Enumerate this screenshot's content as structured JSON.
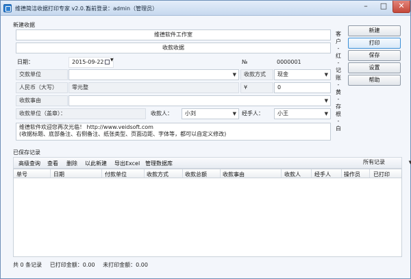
{
  "window": {
    "title": "维德简洁收据打印专家 v2.0.7",
    "current_user": "当前登录：admin（管理员）",
    "controls": {
      "minimize": "–",
      "maximize": "□",
      "close": "✕"
    }
  },
  "receipt_section": {
    "group_label": "新建收据",
    "company_name": "维德软件工作室",
    "receipt_title": "收款收据",
    "date_label": "日期：",
    "date_value": "2015-09-22",
    "number_label": "№",
    "number_value": "0000001",
    "payer_label": "交款单位",
    "payer_value": "",
    "method_label": "收款方式",
    "method_value": "现金",
    "rmb_label": "人民币（大写）",
    "rmb_value": "零元整",
    "yen_label": "¥",
    "amount_value": "0",
    "reason_label": "收款事由",
    "reason_value": "",
    "seal_label": "收款单位（盖章）：",
    "receiver_label": "收款人：",
    "receiver_value": "小刘",
    "handler_label": "经手人：",
    "handler_value": "小王",
    "notes_line1": "维德软件欢迎您再次光临！ http://www.veidsoft.com",
    "notes_line2": "(收据标题、底部备注、右侧备注、纸张类型、页面边距、字体等，都可以自定义修改)",
    "side_note": [
      "客",
      "户",
      "-",
      "红",
      "-",
      "记",
      "账",
      "-",
      "黄",
      "-",
      "存",
      "根",
      "-",
      "白"
    ]
  },
  "buttons": {
    "new": "新建",
    "print": "打印",
    "save": "保存",
    "settings": "设置",
    "help": "帮助"
  },
  "saved_section": {
    "group_label": "已保存记录",
    "toolbar": [
      "高级查询",
      "查看",
      "删除",
      "以此新建",
      "导出Excel",
      "管理数据库"
    ],
    "filter_value": "所有记录",
    "columns": [
      "单号",
      "日期",
      "付款单位",
      "收款方式",
      "收款总额",
      "收款事由",
      "收款人",
      "经手人",
      "操作员",
      "已打印"
    ]
  },
  "status": {
    "records": "共 0 条记录",
    "printed": "已打印金额：0.00",
    "unprinted": "未打印金额：0.00"
  },
  "icons": {
    "dropdown": "chevron-down-icon",
    "calendar": "calendar-icon",
    "app": "app-icon"
  }
}
